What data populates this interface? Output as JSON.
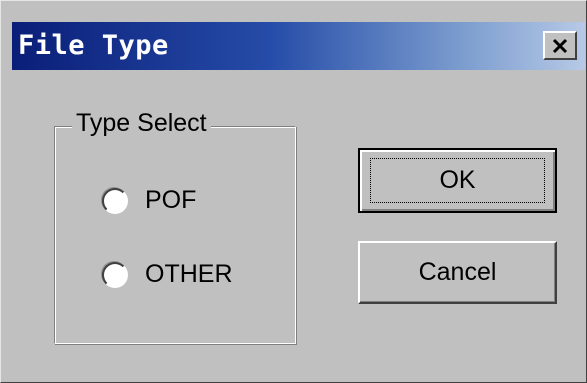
{
  "window": {
    "title": "File Type"
  },
  "title_bar": {
    "close_icon": "close-x-icon",
    "gradient_start": "#0a1e78",
    "gradient_end": "#b7c9e6"
  },
  "group": {
    "label": "Type Select",
    "options": [
      {
        "label": "POF",
        "selected": false
      },
      {
        "label": "OTHER",
        "selected": false
      }
    ]
  },
  "buttons": {
    "ok_label": "OK",
    "cancel_label": "Cancel"
  },
  "colors": {
    "dialog_face": "#c0c0c0",
    "text": "#000000"
  }
}
